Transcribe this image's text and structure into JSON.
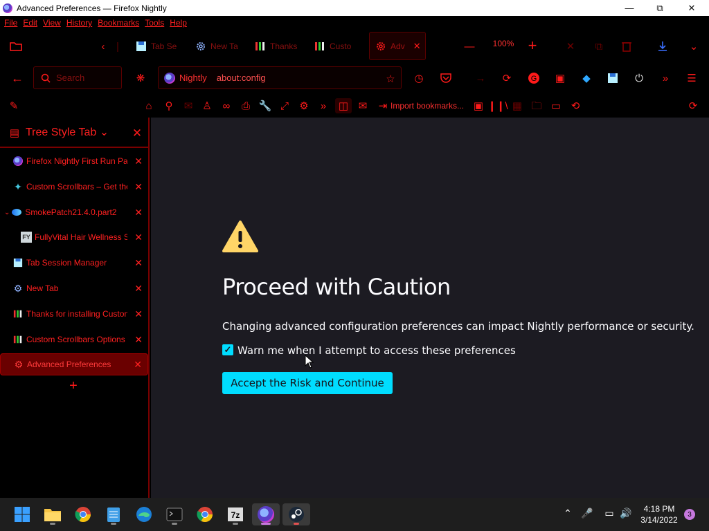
{
  "window": {
    "title": "Advanced Preferences — Firefox Nightly"
  },
  "menu": [
    "File",
    "Edit",
    "View",
    "History",
    "Bookmarks",
    "Tools",
    "Help"
  ],
  "tabs": [
    {
      "label": "Tab Se",
      "icon": "floppy-icon"
    },
    {
      "label": "New Ta",
      "icon": "gear-icon"
    },
    {
      "label": "Thanks",
      "icon": "bars-icon"
    },
    {
      "label": "Custo",
      "icon": "bars-icon"
    },
    {
      "label": "Adv",
      "icon": "gear-icon",
      "active": true
    }
  ],
  "zoom": "100%",
  "navbar": {
    "search_placeholder": "Search",
    "identity": "Nightly",
    "url": "about:config"
  },
  "bookmarks": {
    "import_label": "Import bookmarks..."
  },
  "sidebar": {
    "title": "Tree Style Tab ⌄",
    "items": [
      {
        "label": "Firefox Nightly First Run Pa",
        "favicon": "firefox-icon"
      },
      {
        "label": "Custom Scrollbars – Get the",
        "favicon": "puzzle-icon"
      },
      {
        "label": "SmokePatch21.4.0.part2",
        "favicon": "edge-icon",
        "twisty": true
      },
      {
        "label": "FullyVital Hair Wellness S",
        "favicon": "fy-icon",
        "indent": true
      },
      {
        "label": "Tab Session Manager",
        "favicon": "floppy-icon"
      },
      {
        "label": "New Tab",
        "favicon": "gear-icon"
      },
      {
        "label": "Thanks for installing Custon",
        "favicon": "bars-icon"
      },
      {
        "label": "Custom Scrollbars Options",
        "favicon": "bars-icon"
      },
      {
        "label": "Advanced Preferences",
        "favicon": "gear-icon",
        "active": true
      }
    ]
  },
  "content": {
    "heading": "Proceed with Caution",
    "description": "Changing advanced configuration preferences can impact Nightly performance or security.",
    "checkbox_label": "Warn me when I attempt to access these preferences",
    "checkbox_checked": true,
    "button": "Accept the Risk and Continue"
  },
  "taskbar": {
    "time": "4:18 PM",
    "date": "3/14/2022",
    "notifications": "3",
    "sevenzip_label": "7z"
  },
  "colors": {
    "accent": "#ff1a1a",
    "content_bg": "#1c1b22",
    "button": "#00ddff"
  }
}
